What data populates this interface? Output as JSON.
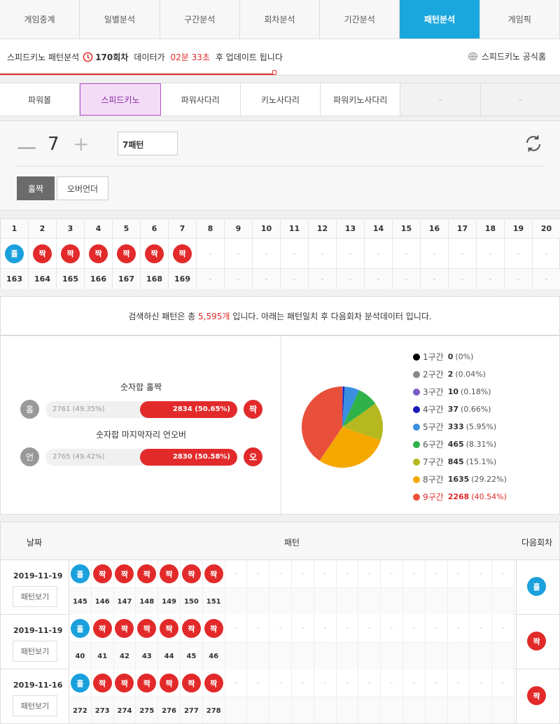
{
  "nav": {
    "tabs": [
      "게임중계",
      "일별분석",
      "구간분석",
      "회차분석",
      "기간분석",
      "패턴분석",
      "게임픽"
    ]
  },
  "info": {
    "title": "스피드키노 패턴분석",
    "round": "170회차",
    "data_text": "데이터가",
    "countdown": "02분 33초",
    "after_text": "후 업데이트 됩니다",
    "official": "스피드키노 공식홈",
    "progress": 0.49
  },
  "games": {
    "tabs": [
      "파워볼",
      "스피드키노",
      "파워사다리",
      "키노사다리",
      "파워키노사다리",
      "-",
      "-"
    ]
  },
  "control": {
    "minus": "—",
    "count": "7",
    "plus": "+",
    "pattern_input": "7패턴",
    "btn_odd_even": "홀짝",
    "btn_over_under": "오버언더"
  },
  "grid": {
    "headers": [
      "1",
      "2",
      "3",
      "4",
      "5",
      "6",
      "7",
      "8",
      "9",
      "10",
      "11",
      "12",
      "13",
      "14",
      "15",
      "16",
      "17",
      "18",
      "19",
      "20"
    ],
    "balls": [
      "홀",
      "짝",
      "짝",
      "짝",
      "짝",
      "짝",
      "짝",
      "-",
      "-",
      "-",
      "-",
      "-",
      "-",
      "-",
      "-",
      "-",
      "-",
      "-",
      "-",
      "-"
    ],
    "rounds": [
      "163",
      "164",
      "165",
      "166",
      "167",
      "168",
      "169",
      "-",
      "-",
      "-",
      "-",
      "-",
      "-",
      "-",
      "-",
      "-",
      "-",
      "-",
      "-",
      "-"
    ]
  },
  "summary": {
    "prefix": "검색하신 패턴은 총",
    "count": "5,595개",
    "suffix": "입니다. 아래는 패턴일치 후 다음회차 분석데이터 입니다."
  },
  "stats": {
    "odd_even": {
      "title": "숫자합 홀짝",
      "left_label": "홀",
      "left_text": "2761 (49.35%)",
      "right_text": "2834 (50.65%)",
      "right_label": "짝",
      "right_ratio": 0.5065
    },
    "under_over": {
      "title": "숫자합 마지막자리 언오버",
      "left_label": "언",
      "left_text": "2765 (49.42%)",
      "right_text": "2830 (50.58%)",
      "right_label": "오",
      "right_ratio": 0.5058
    }
  },
  "chart_data": {
    "type": "pie",
    "slices": [
      {
        "label": "1구간",
        "count": "0",
        "pct": "(0%)",
        "value": 0,
        "color": "#000000"
      },
      {
        "label": "2구간",
        "count": "2",
        "pct": "(0.04%)",
        "value": 2,
        "color": "#888888"
      },
      {
        "label": "3구간",
        "count": "10",
        "pct": "(0.18%)",
        "value": 10,
        "color": "#7a5cc7"
      },
      {
        "label": "4구간",
        "count": "37",
        "pct": "(0.66%)",
        "value": 37,
        "color": "#1a1ab8"
      },
      {
        "label": "5구간",
        "count": "333",
        "pct": "(5.95%)",
        "value": 333,
        "color": "#3a8fe0"
      },
      {
        "label": "6구간",
        "count": "465",
        "pct": "(8.31%)",
        "value": 465,
        "color": "#2fb24a"
      },
      {
        "label": "7구간",
        "count": "845",
        "pct": "(15.1%)",
        "value": 845,
        "color": "#b5b81e"
      },
      {
        "label": "8구간",
        "count": "1635",
        "pct": "(29.22%)",
        "value": 1635,
        "color": "#f5a800"
      },
      {
        "label": "9구간",
        "count": "2268",
        "pct": "(40.54%)",
        "value": 2268,
        "color": "#e8503c"
      }
    ]
  },
  "history": {
    "col_date": "날짜",
    "col_pattern": "패턴",
    "col_next": "다음회차",
    "view_label": "패턴보기",
    "rows": [
      {
        "date": "2019-11-19",
        "balls": [
          "홀",
          "짝",
          "짝",
          "짝",
          "짝",
          "짝",
          "짝",
          "-",
          "-",
          "-",
          "-",
          "-",
          "-",
          "-",
          "-",
          "-",
          "-",
          "-",
          "-",
          "-"
        ],
        "rounds": [
          "145",
          "146",
          "147",
          "148",
          "149",
          "150",
          "151",
          "",
          "",
          "",
          "",
          "",
          "",
          "",
          "",
          "",
          "",
          "",
          "",
          ""
        ],
        "next": "홀"
      },
      {
        "date": "2019-11-19",
        "balls": [
          "홀",
          "짝",
          "짝",
          "짝",
          "짝",
          "짝",
          "짝",
          "-",
          "-",
          "-",
          "-",
          "-",
          "-",
          "-",
          "-",
          "-",
          "-",
          "-",
          "-",
          "-"
        ],
        "rounds": [
          "40",
          "41",
          "42",
          "43",
          "44",
          "45",
          "46",
          "",
          "",
          "",
          "",
          "",
          "",
          "",
          "",
          "",
          "",
          "",
          "",
          ""
        ],
        "next": "짝"
      },
      {
        "date": "2019-11-16",
        "balls": [
          "홀",
          "짝",
          "짝",
          "짝",
          "짝",
          "짝",
          "짝",
          "-",
          "-",
          "-",
          "-",
          "-",
          "-",
          "-",
          "-",
          "-",
          "-",
          "-",
          "-",
          "-"
        ],
        "rounds": [
          "272",
          "273",
          "274",
          "275",
          "276",
          "277",
          "278",
          "",
          "",
          "",
          "",
          "",
          "",
          "",
          "",
          "",
          "",
          "",
          "",
          ""
        ],
        "next": "짝"
      }
    ]
  }
}
